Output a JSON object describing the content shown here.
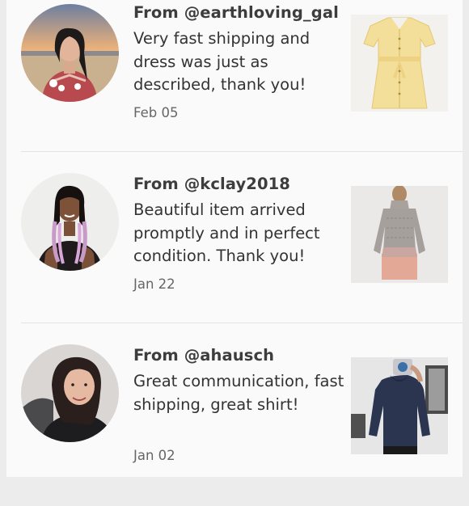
{
  "reviews": [
    {
      "from": "From @earthloving_gal",
      "text": "Very fast shipping and dress was just as described, thank you!",
      "date": "Feb 05",
      "avatar_icon": "reviewer-photo-beach",
      "item_icon": "yellow-dress-photo"
    },
    {
      "from": "From @kclay2018",
      "text": "Beautiful item arrived promptly and in perfect condition. Thank you!",
      "date": "Jan 22",
      "avatar_icon": "reviewer-photo-braids",
      "item_icon": "sweater-dress-photo"
    },
    {
      "from": "From @ahausch",
      "text": "Great communication, fast shipping, great shirt!",
      "date": "Jan 02",
      "avatar_icon": "reviewer-photo-selfie",
      "item_icon": "navy-shirt-photo"
    }
  ],
  "colors": {
    "background": "#fafafa",
    "outer": "#ececec",
    "text": "#333333",
    "date": "#666666"
  }
}
